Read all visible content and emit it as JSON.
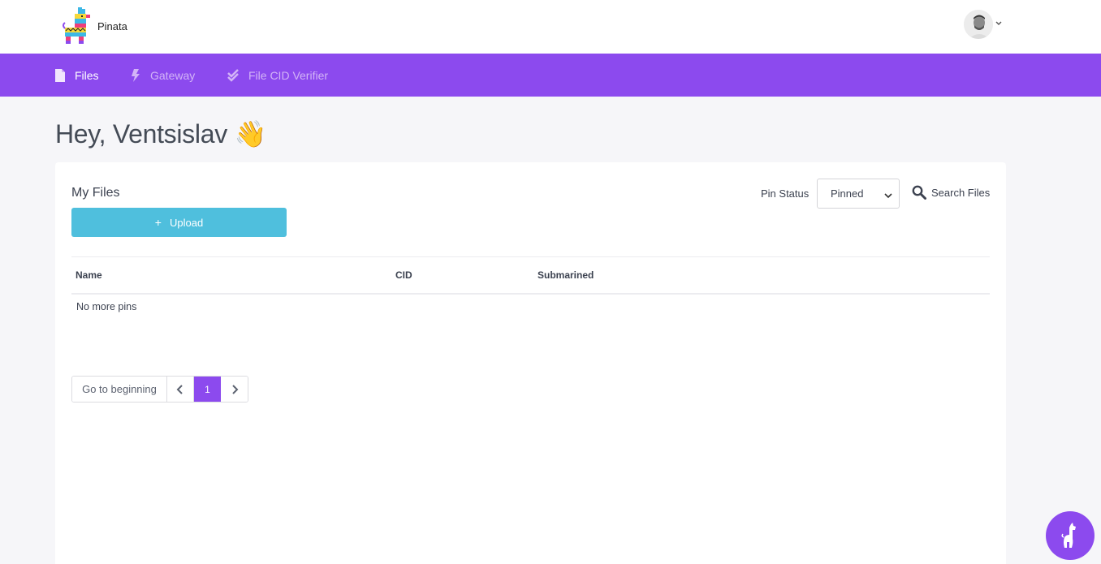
{
  "header": {
    "brand": "Pinata",
    "logo_icon": "pinata-llama-logo",
    "avatar_icon": "user-avatar",
    "avatar_menu_icon": "chevron-down-icon"
  },
  "nav": {
    "accent_color": "#8c4aee",
    "items": [
      {
        "label": "Files",
        "icon": "file-icon",
        "active": true
      },
      {
        "label": "Gateway",
        "icon": "bolt-icon",
        "active": false
      },
      {
        "label": "File CID Verifier",
        "icon": "double-check-icon",
        "active": false
      }
    ]
  },
  "greeting": {
    "text": "Hey, Ventsislav",
    "emoji": "👋"
  },
  "files_card": {
    "title": "My Files",
    "upload_button": {
      "icon": "plus",
      "label": "Upload",
      "color": "#4fbfdd"
    },
    "pin_status_label": "Pin Status",
    "pin_status_value": "Pinned",
    "search_label": "Search Files",
    "table": {
      "columns": [
        "Name",
        "CID",
        "Submarined"
      ],
      "rows": [],
      "empty_message": "No more pins"
    },
    "pagination": {
      "go_to_beginning": "Go to beginning",
      "current_page": "1"
    }
  },
  "chat_widget": {
    "icon": "llama-icon"
  }
}
